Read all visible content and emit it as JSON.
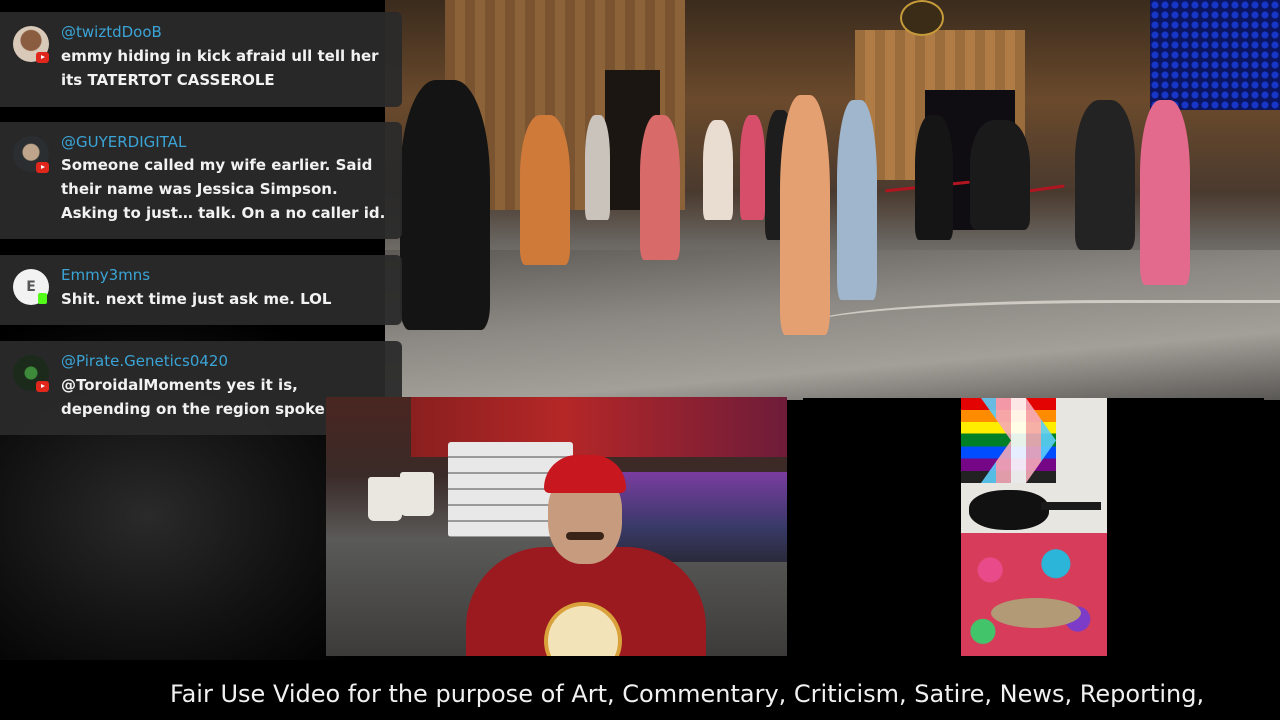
{
  "chat": {
    "messages": [
      {
        "username": "@twiztdDooB",
        "text": "emmy hiding in kick afraid ull tell her its TATERTOT CASSEROLE",
        "platform": "youtube",
        "avatar_icon": "user-avatar-icon"
      },
      {
        "username": "@GUYERDIGITAL",
        "text": "Someone called my wife earlier. Said their name was Jessica Simpson. Asking to just… talk. On a no caller id.",
        "platform": "youtube",
        "avatar_icon": "user-avatar-icon"
      },
      {
        "username": "Emmy3mns",
        "text": "Shit. next time just ask me. LOL",
        "platform": "kick",
        "avatar_letter": "E"
      },
      {
        "username": "@Pirate.Genetics0420",
        "text": "@ToroidalMoments yes it is, depending on the region spoken",
        "platform": "youtube",
        "avatar_icon": "user-avatar-icon"
      }
    ]
  },
  "ticker": {
    "text": "Fair Use Video for the purpose of Art, Commentary, Criticism, Satire, News, Reporting,"
  },
  "colors": {
    "username": "#3ba4d6",
    "chat_bg": "#2a2a2a",
    "youtube_badge": "#e1261c",
    "kick_badge": "#53fc18"
  }
}
